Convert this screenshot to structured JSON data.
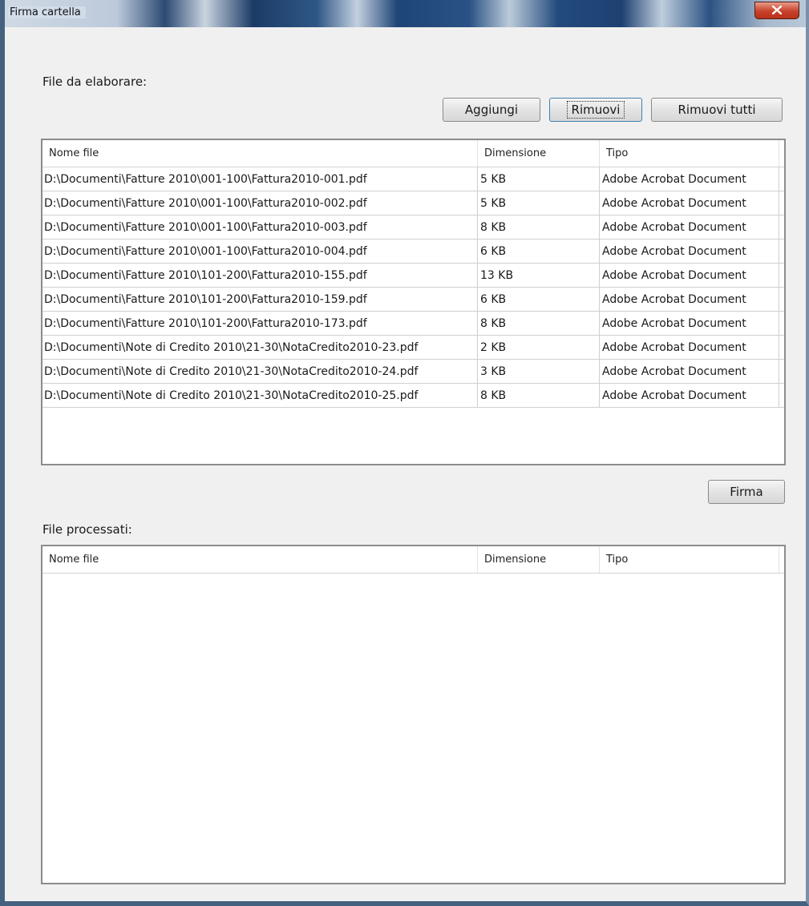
{
  "window": {
    "title": "Firma cartella"
  },
  "queue": {
    "label": "File da elaborare:",
    "buttons": {
      "add": "Aggiungi",
      "remove": "Rimuovi",
      "remove_all": "Rimuovi tutti"
    },
    "columns": [
      "Nome file",
      "Dimensione",
      "Tipo"
    ],
    "rows": [
      {
        "name": "D:\\Documenti\\Fatture 2010\\001-100\\Fattura2010-001.pdf",
        "size": "5 KB",
        "type": "Adobe Acrobat Document"
      },
      {
        "name": "D:\\Documenti\\Fatture 2010\\001-100\\Fattura2010-002.pdf",
        "size": "5 KB",
        "type": "Adobe Acrobat Document"
      },
      {
        "name": "D:\\Documenti\\Fatture 2010\\001-100\\Fattura2010-003.pdf",
        "size": "8 KB",
        "type": "Adobe Acrobat Document"
      },
      {
        "name": "D:\\Documenti\\Fatture 2010\\001-100\\Fattura2010-004.pdf",
        "size": "6 KB",
        "type": "Adobe Acrobat Document"
      },
      {
        "name": "D:\\Documenti\\Fatture 2010\\101-200\\Fattura2010-155.pdf",
        "size": "13 KB",
        "type": "Adobe Acrobat Document"
      },
      {
        "name": "D:\\Documenti\\Fatture 2010\\101-200\\Fattura2010-159.pdf",
        "size": "6 KB",
        "type": "Adobe Acrobat Document"
      },
      {
        "name": "D:\\Documenti\\Fatture 2010\\101-200\\Fattura2010-173.pdf",
        "size": "8 KB",
        "type": "Adobe Acrobat Document"
      },
      {
        "name": "D:\\Documenti\\Note di Credito 2010\\21-30\\NotaCredito2010-23.pdf",
        "size": "2 KB",
        "type": "Adobe Acrobat Document"
      },
      {
        "name": "D:\\Documenti\\Note di Credito 2010\\21-30\\NotaCredito2010-24.pdf",
        "size": "3 KB",
        "type": "Adobe Acrobat Document"
      },
      {
        "name": "D:\\Documenti\\Note di Credito 2010\\21-30\\NotaCredito2010-25.pdf",
        "size": "8 KB",
        "type": "Adobe Acrobat Document"
      }
    ]
  },
  "sign_button": "Firma",
  "processed": {
    "label": "File processati:",
    "columns": [
      "Nome file",
      "Dimensione",
      "Tipo"
    ],
    "rows": []
  }
}
